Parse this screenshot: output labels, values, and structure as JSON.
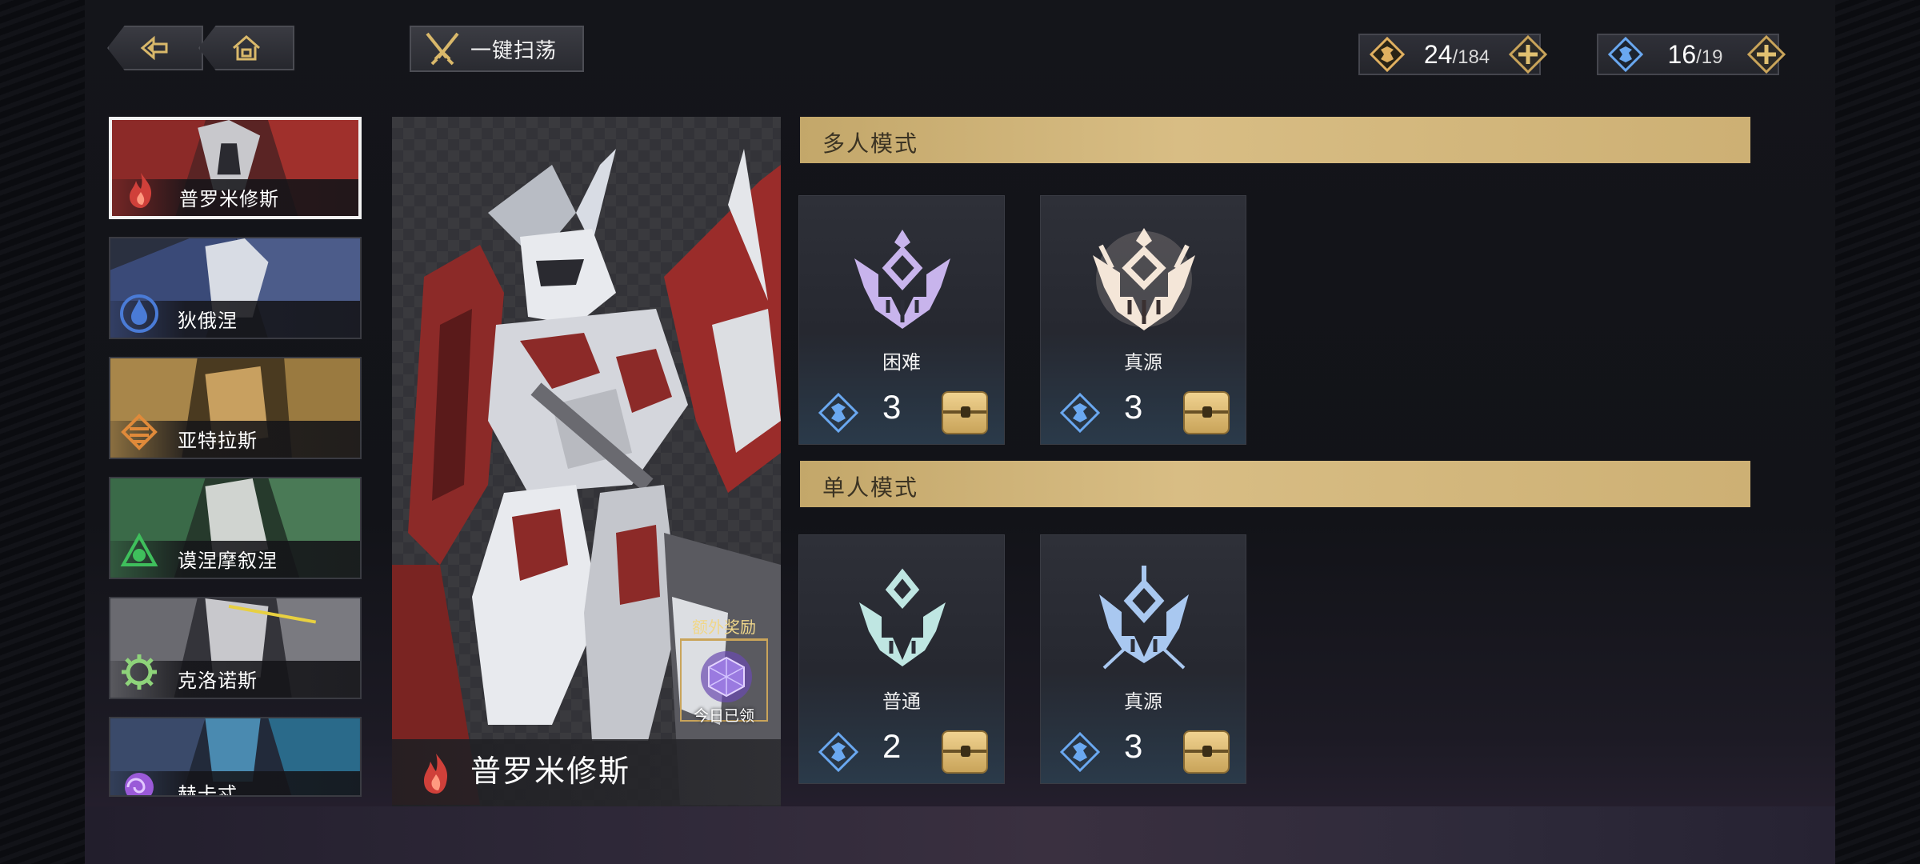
{
  "topbar": {
    "back_icon": "back-arrow-icon",
    "home_icon": "home-icon",
    "sweep_label": "一键扫荡",
    "sweep_icon": "crossed-swords-icon"
  },
  "resources": [
    {
      "icon": "gold-ticket-icon",
      "current": "24",
      "max": "/184",
      "color": "#e0b060"
    },
    {
      "icon": "blue-ticket-icon",
      "current": "16",
      "max": "/19",
      "color": "#6aa8f0"
    }
  ],
  "characters": [
    {
      "name": "普罗米修斯",
      "element": "fire-icon",
      "color": "#d0403a",
      "selected": true
    },
    {
      "name": "狄俄涅",
      "element": "water-icon",
      "color": "#4a7bd6"
    },
    {
      "name": "亚特拉斯",
      "element": "earth-icon",
      "color": "#e08a3a"
    },
    {
      "name": "谟涅摩叙涅",
      "element": "wind-icon",
      "color": "#3fbf5c"
    },
    {
      "name": "克洛诺斯",
      "element": "gear-icon",
      "color": "#8ed37a"
    },
    {
      "name": "赫卡忒",
      "element": "spiral-icon",
      "color": "#9a5ad8"
    }
  ],
  "portrait": {
    "name": "普罗米修斯",
    "element": "fire-icon",
    "bonus_title": "额外奖励",
    "bonus_status": "今日已领"
  },
  "sections": [
    {
      "title": "多人模式",
      "modes": [
        {
          "name": "困难",
          "count": "3",
          "emblem_color": "#c8b4ec"
        },
        {
          "name": "真源",
          "count": "3",
          "emblem_color": "#f4e6d8"
        }
      ]
    },
    {
      "title": "单人模式",
      "modes": [
        {
          "name": "普通",
          "count": "2",
          "emblem_color": "#bfe6e2"
        },
        {
          "name": "真源",
          "count": "3",
          "emblem_color": "#a9c8f0"
        }
      ]
    }
  ]
}
